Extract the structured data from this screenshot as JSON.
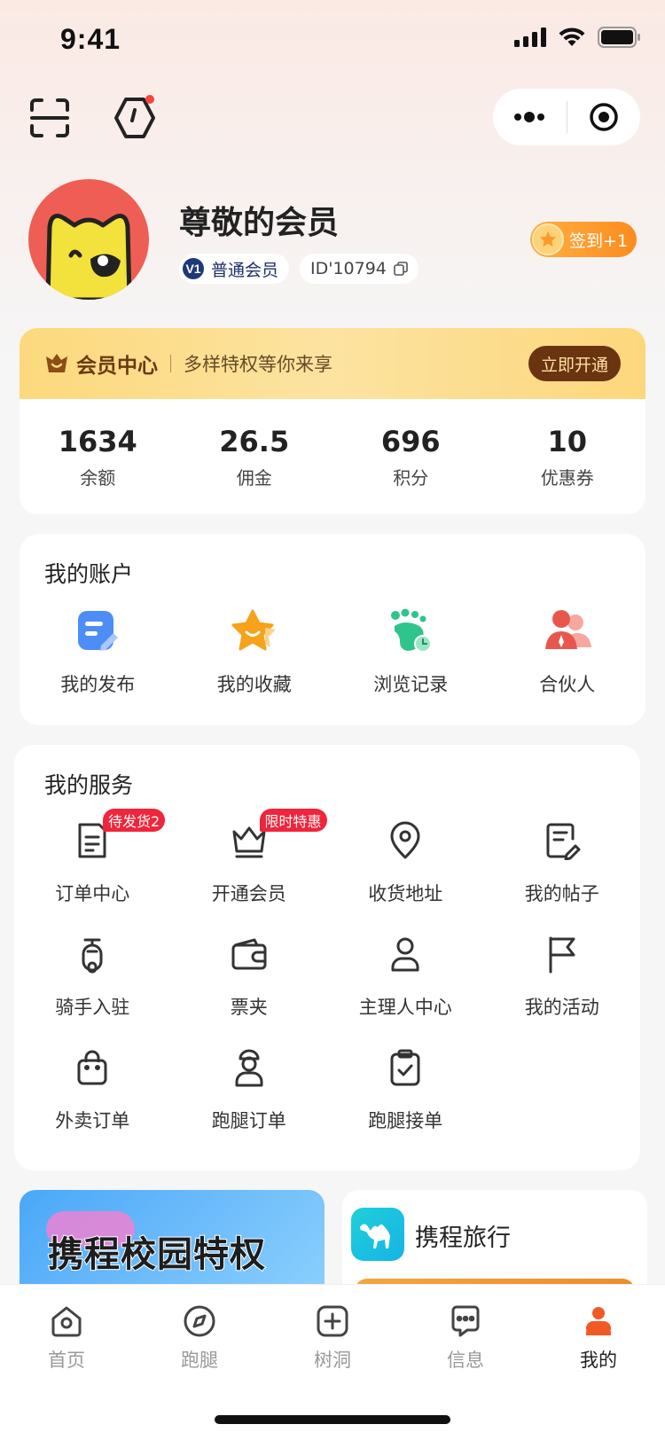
{
  "status_bar": {
    "time": "9:41"
  },
  "profile": {
    "name": "尊敬的会员",
    "level_badge": "V1",
    "level_label": "普通会员",
    "user_id": "ID'10794",
    "checkin_label": "签到+1"
  },
  "member_card": {
    "title": "会员中心",
    "subtitle": "多样特权等你来享",
    "button": "立即开通",
    "stats": [
      {
        "value": "1634",
        "label": "余额"
      },
      {
        "value": "26.5",
        "label": "佣金"
      },
      {
        "value": "696",
        "label": "积分"
      },
      {
        "value": "10",
        "label": "优惠券"
      }
    ]
  },
  "account": {
    "title": "我的账户",
    "items": [
      {
        "label": "我的发布",
        "icon": "edit-doc-icon"
      },
      {
        "label": "我的收藏",
        "icon": "star-icon"
      },
      {
        "label": "浏览记录",
        "icon": "footprint-icon"
      },
      {
        "label": "合伙人",
        "icon": "partner-icon"
      }
    ]
  },
  "services": {
    "title": "我的服务",
    "rows": [
      [
        {
          "label": "订单中心",
          "icon": "order-icon",
          "tag": "待发货2"
        },
        {
          "label": "开通会员",
          "icon": "crown-icon",
          "tag": "限时特惠"
        },
        {
          "label": "收货地址",
          "icon": "location-icon"
        },
        {
          "label": "我的帖子",
          "icon": "post-icon"
        }
      ],
      [
        {
          "label": "骑手入驻",
          "icon": "scooter-icon"
        },
        {
          "label": "票夹",
          "icon": "wallet-icon"
        },
        {
          "label": "主理人中心",
          "icon": "person-icon"
        },
        {
          "label": "我的活动",
          "icon": "flag-icon"
        }
      ],
      [
        {
          "label": "外卖订单",
          "icon": "bag-icon"
        },
        {
          "label": "跑腿订单",
          "icon": "courier-icon"
        },
        {
          "label": "跑腿接单",
          "icon": "clipboard-check-icon"
        }
      ]
    ]
  },
  "promo": {
    "left_text": "携程校园特权",
    "right_name": "携程旅行"
  },
  "tabbar": {
    "tabs": [
      {
        "label": "首页",
        "icon": "home-icon",
        "active": false
      },
      {
        "label": "跑腿",
        "icon": "compass-icon",
        "active": false
      },
      {
        "label": "树洞",
        "icon": "plus-square-icon",
        "active": false
      },
      {
        "label": "信息",
        "icon": "message-icon",
        "active": false
      },
      {
        "label": "我的",
        "icon": "user-icon",
        "active": true
      }
    ]
  },
  "colors": {
    "accent_orange": "#fb8c1e",
    "tag_red": "#f0243a",
    "member_brown": "#6a3410",
    "tab_active": "#f15a24"
  }
}
